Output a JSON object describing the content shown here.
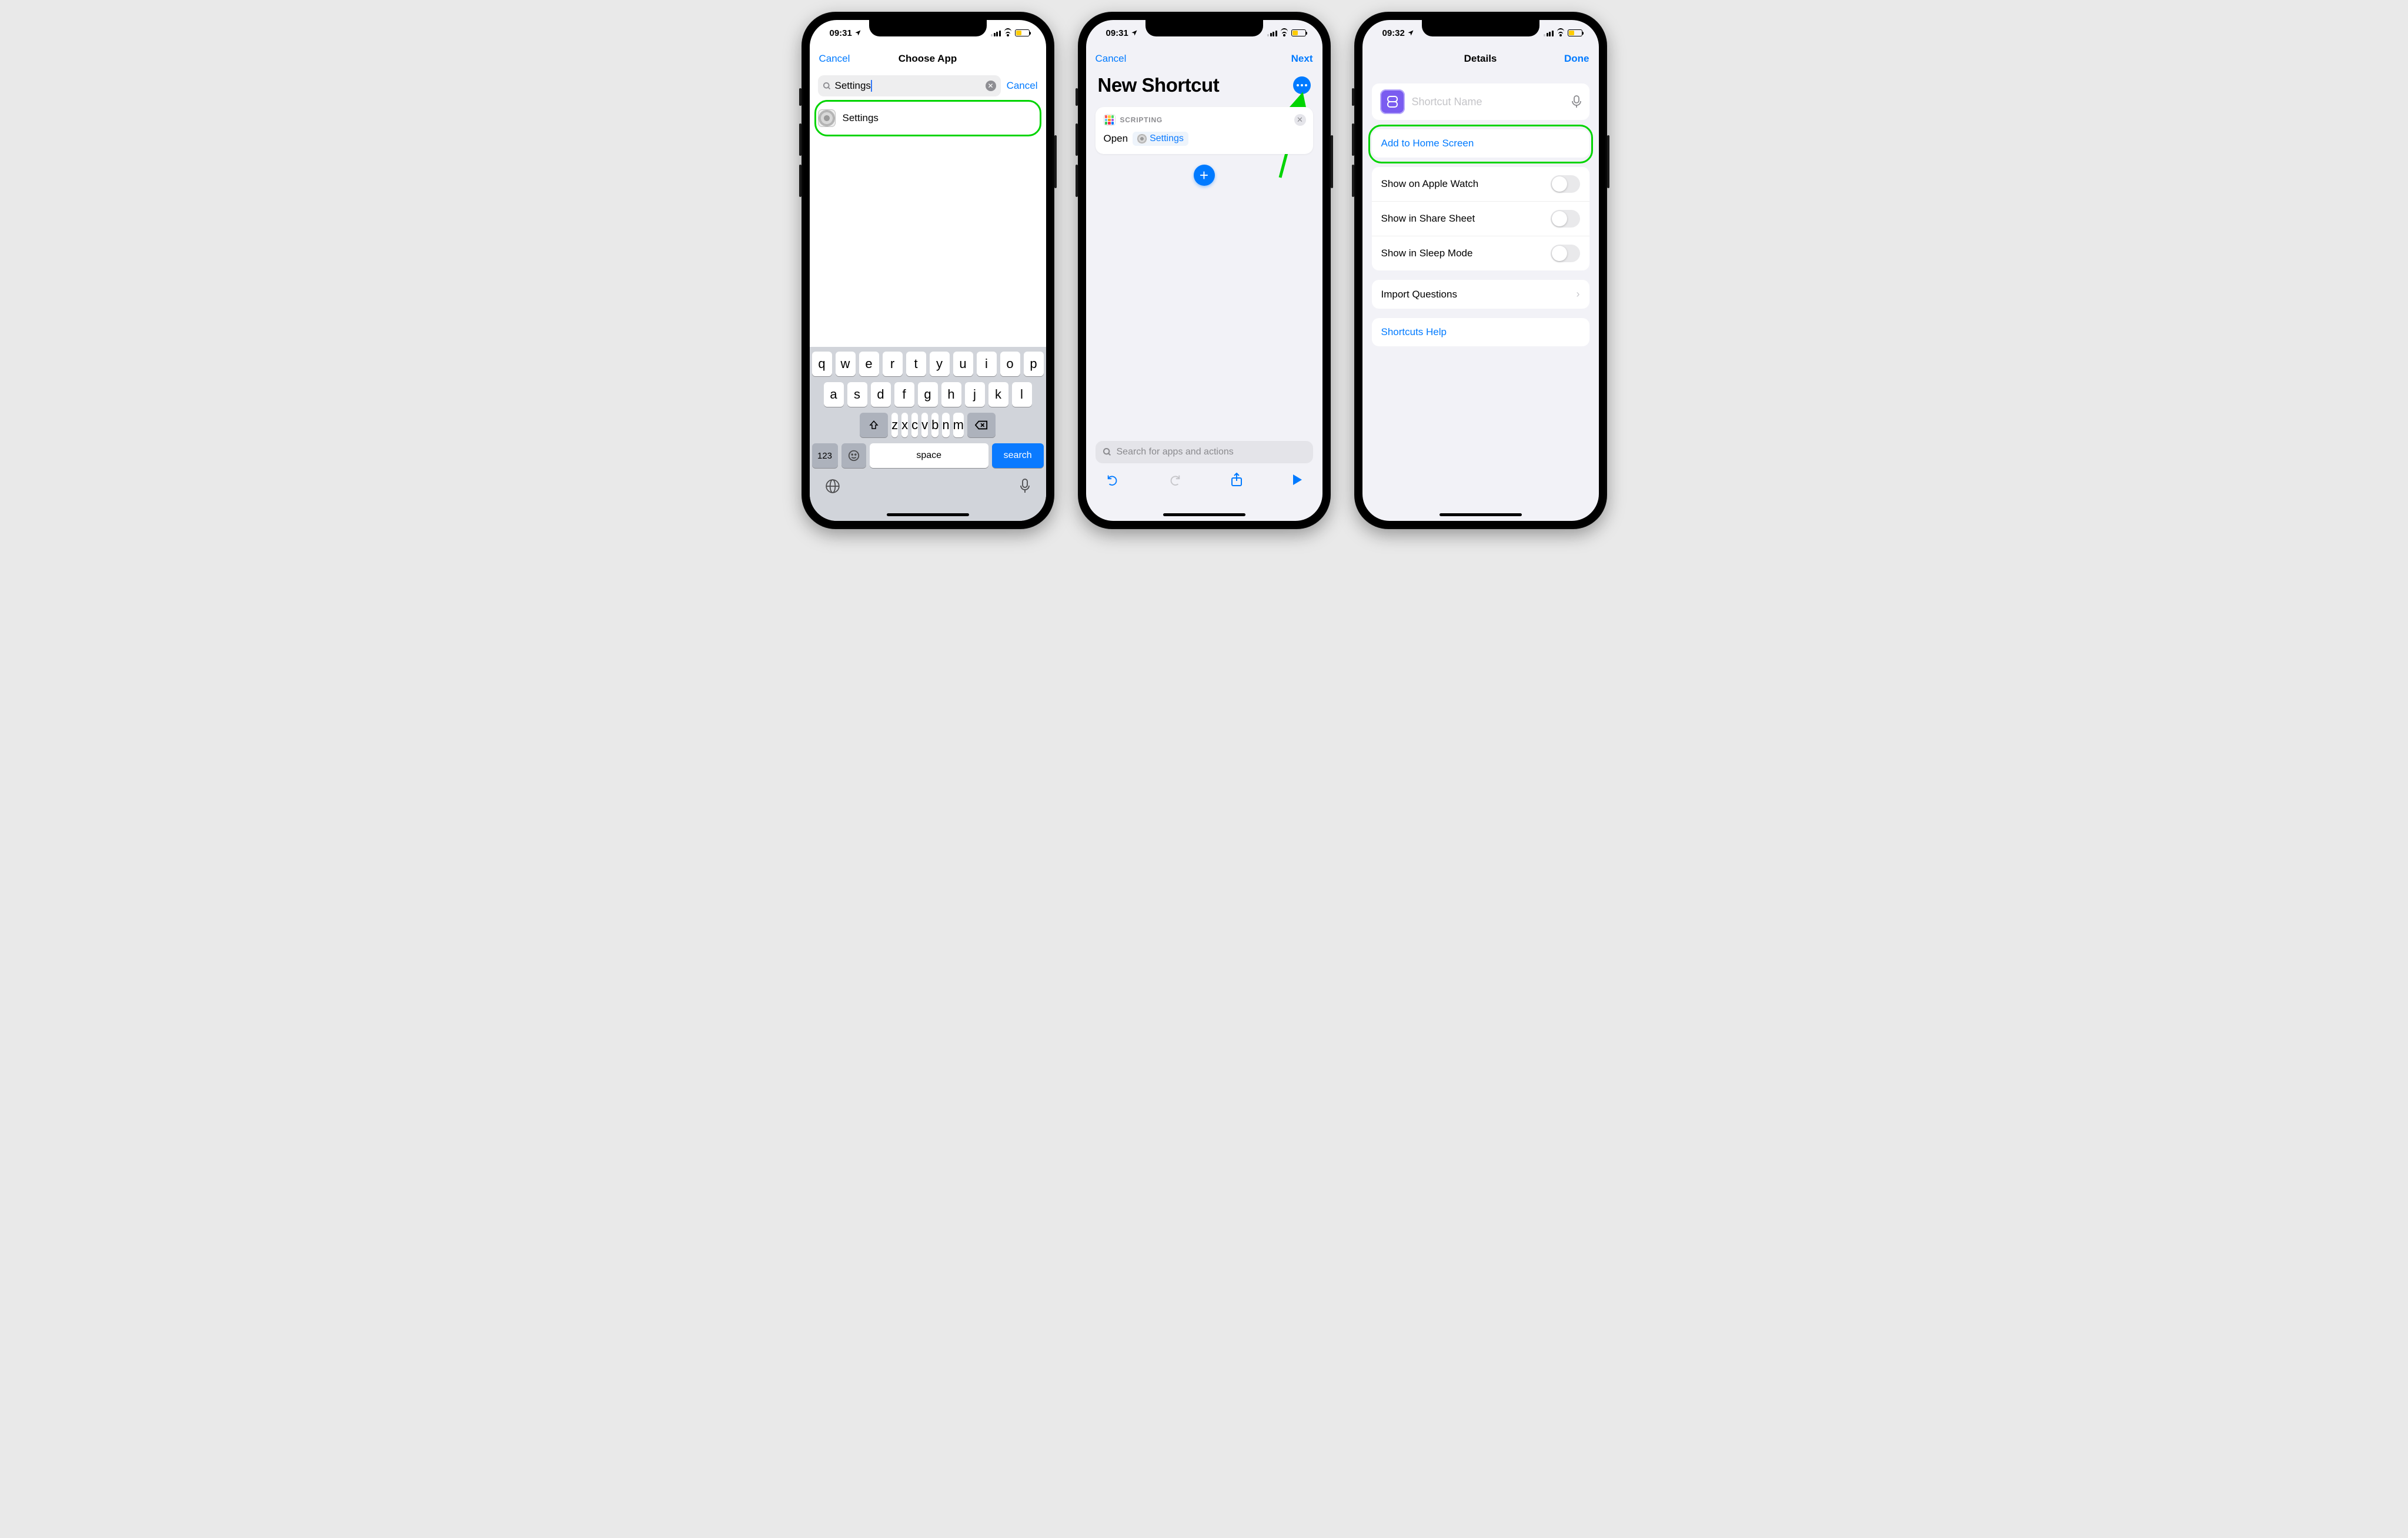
{
  "phone1": {
    "status_time": "09:31",
    "nav_cancel": "Cancel",
    "nav_title": "Choose App",
    "search_value": "Settings",
    "search_cancel": "Cancel",
    "result_label": "Settings",
    "keyboard": {
      "row1": [
        "q",
        "w",
        "e",
        "r",
        "t",
        "y",
        "u",
        "i",
        "o",
        "p"
      ],
      "row2": [
        "a",
        "s",
        "d",
        "f",
        "g",
        "h",
        "j",
        "k",
        "l"
      ],
      "row3": [
        "z",
        "x",
        "c",
        "v",
        "b",
        "n",
        "m"
      ],
      "num": "123",
      "space": "space",
      "action": "search"
    }
  },
  "phone2": {
    "status_time": "09:31",
    "nav_cancel": "Cancel",
    "nav_next": "Next",
    "title": "New Shortcut",
    "card_category": "SCRIPTING",
    "card_verb": "Open",
    "card_param": "Settings",
    "search_placeholder": "Search for apps and actions"
  },
  "phone3": {
    "status_time": "09:32",
    "nav_title": "Details",
    "nav_done": "Done",
    "name_placeholder": "Shortcut Name",
    "add_home": "Add to Home Screen",
    "row_watch": "Show on Apple Watch",
    "row_share": "Show in Share Sheet",
    "row_sleep": "Show in Sleep Mode",
    "row_import": "Import Questions",
    "row_help": "Shortcuts Help"
  }
}
